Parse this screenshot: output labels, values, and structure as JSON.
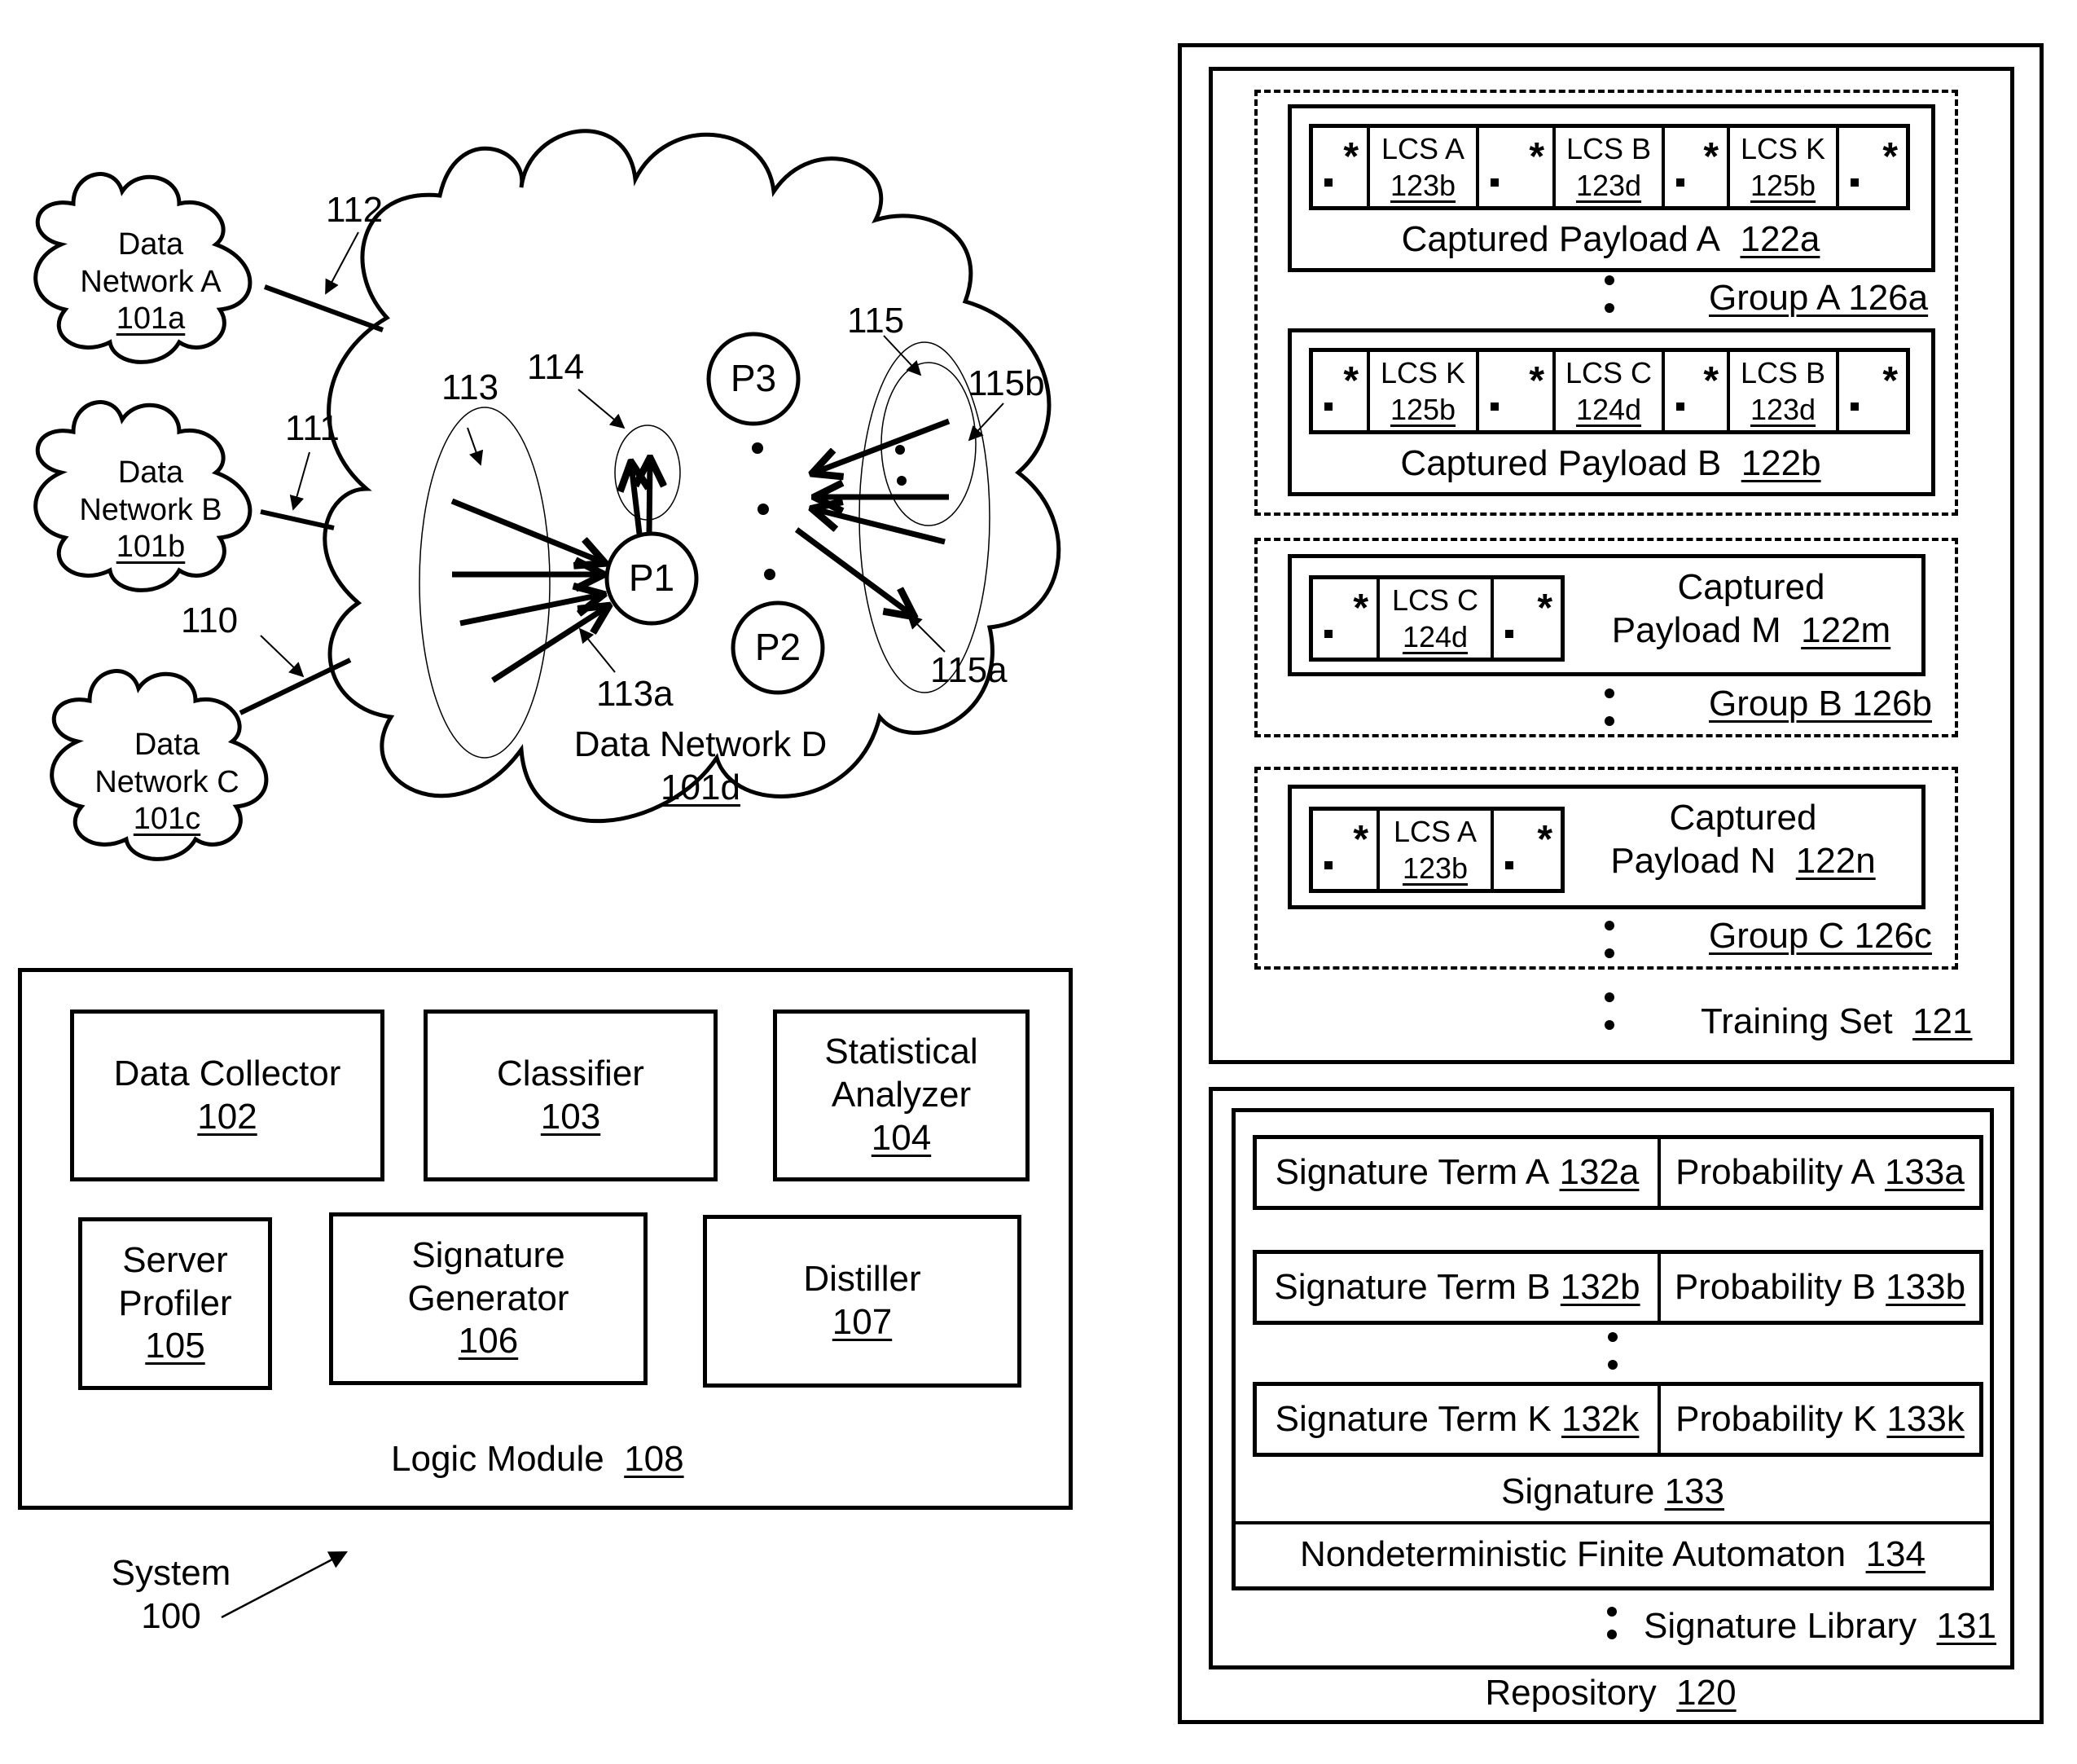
{
  "network": {
    "clouds": [
      {
        "id": "a",
        "line1": "Data",
        "line2": "Network A",
        "ref": "101a"
      },
      {
        "id": "b",
        "line1": "Data",
        "line2": "Network B",
        "ref": "101b"
      },
      {
        "id": "c",
        "line1": "Data",
        "line2": "Network C",
        "ref": "101c"
      }
    ],
    "main_cloud": {
      "title": "Data Network D",
      "ref": "101d"
    },
    "links": {
      "link_a": "112",
      "link_b": "111",
      "link_c": "110"
    },
    "nodes": {
      "p1": "P1",
      "p2": "P2",
      "p3": "P3"
    },
    "callouts": {
      "c113": "113",
      "c113a": "113a",
      "c114": "114",
      "c115": "115",
      "c115a": "115a",
      "c115b": "115b"
    }
  },
  "logic_module": {
    "title": "Logic Module",
    "ref": "108",
    "components": [
      {
        "lines": [
          "Data Collector"
        ],
        "ref": "102"
      },
      {
        "lines": [
          "Classifier"
        ],
        "ref": "103"
      },
      {
        "lines": [
          "Statistical",
          "Analyzer"
        ],
        "ref": "104"
      },
      {
        "lines": [
          "Server",
          "Profiler"
        ],
        "ref": "105"
      },
      {
        "lines": [
          "Signature",
          "Generator"
        ],
        "ref": "106"
      },
      {
        "lines": [
          "Distiller"
        ],
        "ref": "107"
      }
    ]
  },
  "system": {
    "label": "System",
    "ref": "100"
  },
  "repository": {
    "title": "Repository",
    "ref": "120",
    "training_set": {
      "title": "Training Set",
      "ref": "121",
      "groups": [
        {
          "label": "Group A 126a",
          "payloads": [
            {
              "title": "Captured Payload A",
              "ref": "122a",
              "lcs": [
                {
                  "name": "LCS A",
                  "ref": "123b"
                },
                {
                  "name": "LCS B",
                  "ref": "123d"
                },
                {
                  "name": "LCS K",
                  "ref": "125b"
                }
              ]
            },
            {
              "title": "Captured Payload B",
              "ref": "122b",
              "lcs": [
                {
                  "name": "LCS K",
                  "ref": "125b"
                },
                {
                  "name": "LCS C",
                  "ref": "124d"
                },
                {
                  "name": "LCS B",
                  "ref": "123d"
                }
              ]
            }
          ]
        },
        {
          "label": "Group B 126b",
          "payloads": [
            {
              "title_line1": "Captured",
              "title_line2": "Payload M",
              "ref": "122m",
              "lcs": [
                {
                  "name": "LCS C",
                  "ref": "124d"
                }
              ]
            }
          ]
        },
        {
          "label": "Group C 126c",
          "payloads": [
            {
              "title_line1": "Captured",
              "title_line2": "Payload N",
              "ref": "122n",
              "lcs": [
                {
                  "name": "LCS A",
                  "ref": "123b"
                }
              ]
            }
          ]
        }
      ],
      "wildcard_symbol": "*"
    },
    "signature_library": {
      "title": "Signature Library",
      "ref": "131",
      "signature": {
        "title": "Signature",
        "ref": "133",
        "terms": [
          {
            "term": "Signature Term A",
            "term_ref": "132a",
            "prob": "Probability A",
            "prob_ref": "133a"
          },
          {
            "term": "Signature Term B",
            "term_ref": "132b",
            "prob": "Probability B",
            "prob_ref": "133b"
          },
          {
            "term": "Signature Term K",
            "term_ref": "132k",
            "prob": "Probability K",
            "prob_ref": "133k"
          }
        ]
      },
      "nfa": {
        "title": "Nondeterministic Finite Automaton",
        "ref": "134"
      }
    }
  }
}
